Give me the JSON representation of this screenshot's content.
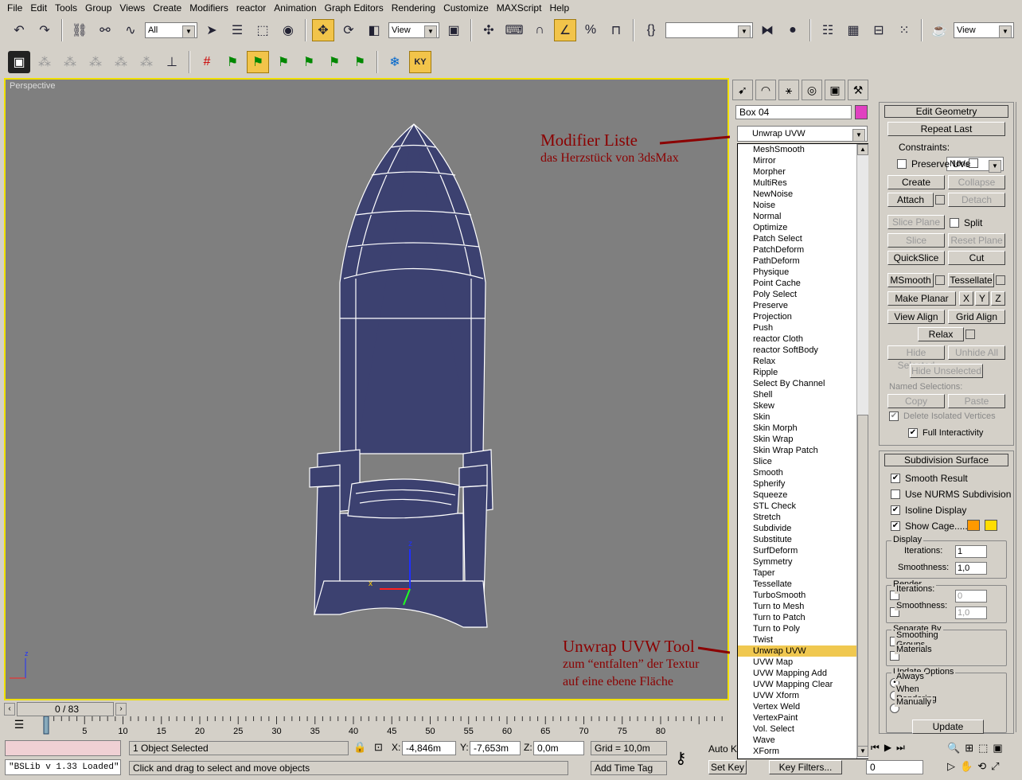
{
  "menu": [
    "File",
    "Edit",
    "Tools",
    "Group",
    "Views",
    "Create",
    "Modifiers",
    "reactor",
    "Animation",
    "Graph Editors",
    "Rendering",
    "Customize",
    "MAXScript",
    "Help"
  ],
  "toolbar": {
    "selection_filter": "All",
    "ref_coord": "View",
    "ref_coord2": "View"
  },
  "viewport": {
    "label": "Perspective",
    "axis_z": "z",
    "axis_x": "x"
  },
  "timeline": {
    "frame": "0 / 83",
    "ticks": [
      "0",
      "5",
      "10",
      "15",
      "20",
      "25",
      "30",
      "35",
      "40",
      "45",
      "50",
      "55",
      "60",
      "65",
      "70",
      "75",
      "80"
    ]
  },
  "status": {
    "script": "\"BSLib v 1.33 Loaded\"",
    "selected": "1 Object Selected",
    "prompt": "Click and drag to select and move objects",
    "x_label": "X:",
    "x": "-4,846m",
    "y_label": "Y:",
    "y": "-7,653m",
    "z_label": "Z:",
    "z": "0,0m",
    "grid": "Grid = 10,0m",
    "add_time_tag": "Add Time Tag",
    "auto_key": "Auto K",
    "set_key": "Set Key",
    "key_filters": "Key Filters...",
    "frame_field": "0"
  },
  "command_panel": {
    "object_name": "Box 04",
    "object_color": "#e040c0",
    "modifier_dropdown": "Unwrap UVW",
    "modifiers": [
      "MeshSmooth",
      "Mirror",
      "Morpher",
      "MultiRes",
      "NewNoise",
      "Noise",
      "Normal",
      "Optimize",
      "Patch Select",
      "PatchDeform",
      "PathDeform",
      "Physique",
      "Point Cache",
      "Poly Select",
      "Preserve",
      "Projection",
      "Push",
      "reactor Cloth",
      "reactor SoftBody",
      "Relax",
      "Ripple",
      "Select By Channel",
      "Shell",
      "Skew",
      "Skin",
      "Skin Morph",
      "Skin Wrap",
      "Skin Wrap Patch",
      "Slice",
      "Smooth",
      "Spherify",
      "Squeeze",
      "STL Check",
      "Stretch",
      "Subdivide",
      "Substitute",
      "SurfDeform",
      "Symmetry",
      "Taper",
      "Tessellate",
      "TurboSmooth",
      "Turn to Mesh",
      "Turn to Patch",
      "Turn to Poly",
      "Twist",
      "Unwrap UVW",
      "UVW Map",
      "UVW Mapping Add",
      "UVW Mapping Clear",
      "UVW Xform",
      "Vertex Weld",
      "VertexPaint",
      "Vol. Select",
      "Wave",
      "XForm"
    ],
    "selected_modifier": "Unwrap UVW"
  },
  "edit_geometry": {
    "title": "Edit Geometry",
    "repeat_last": "Repeat Last",
    "constraints_label": "Constraints:",
    "constraints_value": "None",
    "preserve_uvs": "Preserve UVs",
    "create": "Create",
    "collapse": "Collapse",
    "attach": "Attach",
    "detach": "Detach",
    "slice_plane": "Slice Plane",
    "split": "Split",
    "slice": "Slice",
    "reset_plane": "Reset Plane",
    "quickslice": "QuickSlice",
    "cut": "Cut",
    "msmooth": "MSmooth",
    "tessellate": "Tessellate",
    "make_planar": "Make Planar",
    "x": "X",
    "y": "Y",
    "z": "Z",
    "view_align": "View Align",
    "grid_align": "Grid Align",
    "relax": "Relax",
    "hide_selected": "Hide Selected",
    "unhide_all": "Unhide All",
    "hide_unselected": "Hide Unselected",
    "named_selections": "Named Selections:",
    "copy": "Copy",
    "paste": "Paste",
    "delete_isolated": "Delete Isolated Vertices",
    "full_interactivity": "Full Interactivity"
  },
  "subdivision": {
    "title": "Subdivision Surface",
    "smooth_result": "Smooth Result",
    "use_nurms": "Use NURMS Subdivision",
    "isoline": "Isoline Display",
    "show_cage": "Show Cage......",
    "display": "Display",
    "iterations": "Iterations:",
    "iterations_val": "1",
    "smoothness": "Smoothness:",
    "smoothness_val": "1,0",
    "render": "Render",
    "r_iterations_val": "0",
    "r_smoothness_val": "1,0",
    "separate_by": "Separate By",
    "smoothing_groups": "Smoothing Groups",
    "materials": "Materials",
    "update_options": "Update Options",
    "always": "Always",
    "when_rendering": "When Rendering",
    "manually": "Manually",
    "update": "Update",
    "cage_color1": "#ff9900",
    "cage_color2": "#ffdd00"
  },
  "annotations": {
    "a1_title": "Modifier Liste",
    "a1_sub": "das Herzstück von 3dsMax",
    "a2_title": "Unwrap UVW Tool",
    "a2_line1": "zum “entfalten” der Textur",
    "a2_line2": "auf eine ebene Fläche"
  }
}
